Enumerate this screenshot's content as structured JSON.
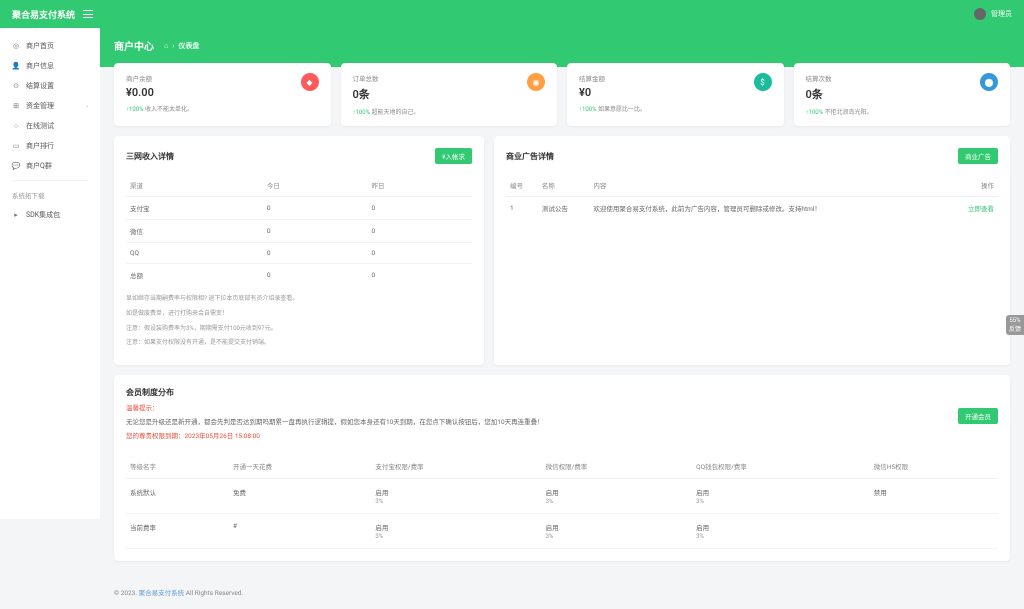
{
  "brand": "聚合易支付系统",
  "user": {
    "name": "管理员"
  },
  "sidebar": {
    "items": [
      {
        "icon": "◎",
        "label": "商户首页"
      },
      {
        "icon": "👤",
        "label": "商户信息"
      },
      {
        "icon": "⊙",
        "label": "结算设置"
      },
      {
        "icon": "⊞",
        "label": "资金管理",
        "children": true
      },
      {
        "icon": "○",
        "label": "在线测试"
      },
      {
        "icon": "▭",
        "label": "商户排行"
      },
      {
        "icon": "💬",
        "label": "商户Q群"
      }
    ],
    "section_label": "系统拓下载",
    "extra": [
      {
        "icon": "▸",
        "label": "SDK集成包"
      }
    ]
  },
  "page": {
    "title": "商户中心",
    "bc_home": "⌂",
    "bc_current": "仪表盘"
  },
  "stats": [
    {
      "label": "商户余额",
      "value": "¥0.00",
      "up": "↑100%",
      "note": " 收入不能太单化。"
    },
    {
      "label": "订单总数",
      "value": "0条",
      "up": "↑100%",
      "note": " 超能天地的自己。"
    },
    {
      "label": "结算金额",
      "value": "¥0",
      "up": "↑100%",
      "note": " 如果意愿比一比。"
    },
    {
      "label": "结算次数",
      "value": "0条",
      "up": "↑100%",
      "note": " 不拒北浪岛光阳。"
    }
  ],
  "income": {
    "title": "三网收入详情",
    "button": "¥入帐求",
    "headers": [
      "渠道",
      "今日",
      "昨日"
    ],
    "rows": [
      {
        "c": "支付宝",
        "t": "0",
        "y": "0"
      },
      {
        "c": "微信",
        "t": "0",
        "y": "0"
      },
      {
        "c": "QQ",
        "t": "0",
        "y": "0"
      },
      {
        "c": "总额",
        "t": "0",
        "y": "0"
      }
    ],
    "notes": [
      "显如继存当期嗣费率与权限相? 退下拉本页底部有员介绍录查看。",
      "如是做废费单，进行打购来会自需变！",
      "注意：假设装购费率为3%，期期需支付100元收到97元。",
      "注意：如果支付权限没有开通，是不能提交支付销端。"
    ]
  },
  "ads": {
    "title": "商业广告详情",
    "button": "商业广告",
    "headers": [
      "编号",
      "名称",
      "内容",
      "操作"
    ],
    "rows": [
      {
        "id": "1",
        "name": "测试公告",
        "content": "欢迎使用聚合易支付系统，此前为广告内容，管理员可删除或修改。支持html！",
        "action": "立即查看"
      }
    ]
  },
  "member": {
    "title": "会员制度分布",
    "tip_label": "温馨提示：",
    "tip_text": "无论您是升级还是新开通，都会先判是否达到期吗期累一盘再执行逻辑提，假如您本身还有10天到期，在您点下确认按钮后，您加10天再连重叠！",
    "expire": "您的尊贵权限到期：2023年05月26日 15:08:00",
    "button": "开通会员",
    "headers": [
      "等级名字",
      "开通一天花费",
      "支付宝权限/费率",
      "微信权限/费率",
      "QQ钱包权限/费率",
      "微信H5权限"
    ],
    "rows": [
      {
        "name": "系统默认",
        "cost": "免费",
        "ali": "启用",
        "ali_r": "3%",
        "wx": "启用",
        "wx_r": "3%",
        "qq": "启用",
        "qq_r": "3%",
        "h5": "禁用"
      },
      {
        "name": "当前费率",
        "cost": "#",
        "ali": "启用",
        "ali_r": "3%",
        "wx": "启用",
        "wx_r": "3%",
        "qq": "启用",
        "qq_r": "3%",
        "h5": ""
      }
    ]
  },
  "footer": {
    "year": "© 2023.",
    "link": "聚合易支付系统",
    "rest": " All Rights Reserved."
  },
  "feedback": {
    "pct": "55%",
    "label": "反馈"
  }
}
